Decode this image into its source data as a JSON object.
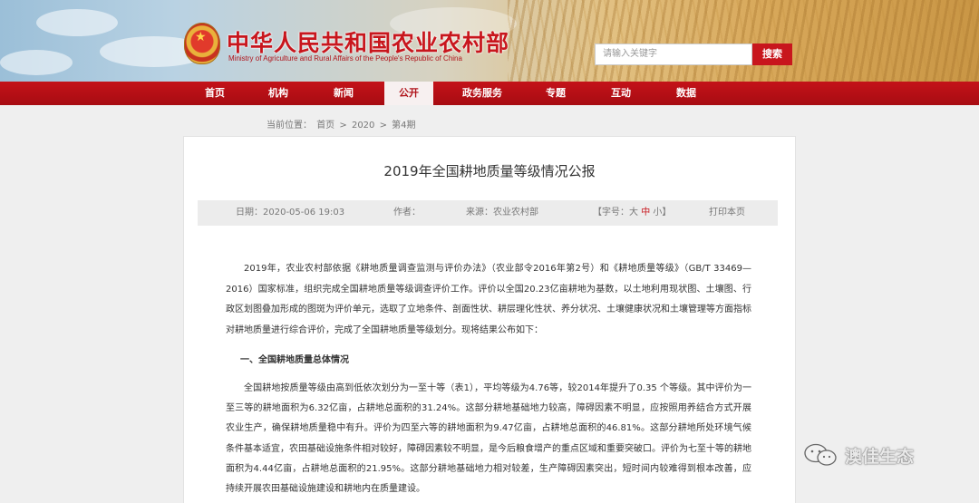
{
  "header": {
    "site_title": "中华人民共和国农业农村部",
    "site_subtitle": "Ministry of Agriculture and Rural Affairs of the People's Republic of China",
    "search_placeholder": "请输入关键字",
    "search_button": "搜索"
  },
  "nav": {
    "items": [
      {
        "label": "首页"
      },
      {
        "label": "机构"
      },
      {
        "label": "新闻"
      },
      {
        "label": "公开"
      },
      {
        "label": "政务服务"
      },
      {
        "label": "专题"
      },
      {
        "label": "互动"
      },
      {
        "label": "数据"
      }
    ],
    "active_label": "公开"
  },
  "breadcrumb": {
    "prefix": "当前位置：",
    "items": [
      "首页",
      "2020",
      "第4期"
    ],
    "separator": ">"
  },
  "article": {
    "title": "2019年全国耕地质量等级情况公报",
    "meta": {
      "date": "日期：2020-05-06 19:03",
      "author": "作者：",
      "source": "来源：农业农村部",
      "font_size_prefix": "【字号：",
      "font_size_large": "大",
      "font_size_medium": "中",
      "font_size_small": "小",
      "font_size_suffix": "】",
      "print": "打印本页"
    },
    "paragraph1": "2019年，农业农村部依据《耕地质量调查监测与评价办法》（农业部令2016年第2号）和《耕地质量等级》（GB/T 33469—2016）国家标准，组织完成全国耕地质量等级调查评价工作。评价以全国20.23亿亩耕地为基数，以土地利用现状图、土壤图、行政区划图叠加形成的图斑为评价单元，选取了立地条件、剖面性状、耕层理化性状、养分状况、土壤健康状况和土壤管理等方面指标对耕地质量进行综合评价，完成了全国耕地质量等级划分。现将结果公布如下：",
    "section1": "一、全国耕地质量总体情况",
    "paragraph2": "全国耕地按质量等级由高到低依次划分为一至十等（表1），平均等级为4.76等，较2014年提升了0.35 个等级。其中评价为一至三等的耕地面积为6.32亿亩，占耕地总面积的31.24%。这部分耕地基础地力较高，障碍因素不明显，应按照用养结合方式开展农业生产，确保耕地质量稳中有升。评价为四至六等的耕地面积为9.47亿亩，占耕地总面积的46.81%。这部分耕地所处环境气候条件基本适宜，农田基础设施条件相对较好，障碍因素较不明显，是今后粮食增产的重点区域和重要突破口。评价为七至十等的耕地面积为4.44亿亩，占耕地总面积的21.95%。这部分耕地基础地力相对较差，生产障碍因素突出，短时间内较难得到根本改善，应持续开展农田基础设施建设和耕地内在质量建设。"
  },
  "watermark": {
    "text": "澳佳生态",
    "icon": "wechat-icon"
  },
  "colors": {
    "brand_red": "#c8161d",
    "nav_red": "#b50f16",
    "page_bg": "#efefef"
  }
}
